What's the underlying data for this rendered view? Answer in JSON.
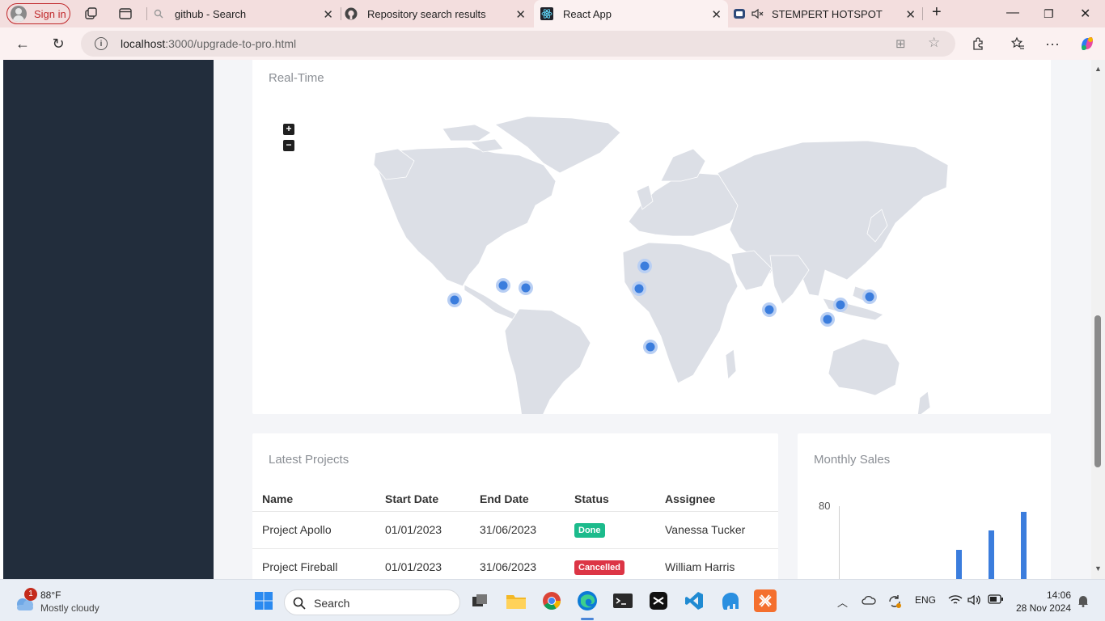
{
  "browser": {
    "signin_label": "Sign in",
    "tabs": [
      {
        "title": "github - Search"
      },
      {
        "title": "Repository search results"
      },
      {
        "title": "React App"
      },
      {
        "title": "STEMPERT HOTSPOT"
      }
    ],
    "url_host": "localhost",
    "url_path": ":3000/upgrade-to-pro.html"
  },
  "realtime": {
    "title": "Real-Time",
    "zoom_in": "+",
    "zoom_out": "−"
  },
  "projects": {
    "title": "Latest Projects",
    "columns": [
      "Name",
      "Start Date",
      "End Date",
      "Status",
      "Assignee"
    ],
    "rows": [
      {
        "name": "Project Apollo",
        "start": "01/01/2023",
        "end": "31/06/2023",
        "status": "Done",
        "assignee": "Vanessa Tucker"
      },
      {
        "name": "Project Fireball",
        "start": "01/01/2023",
        "end": "31/06/2023",
        "status": "Cancelled",
        "assignee": "William Harris"
      }
    ]
  },
  "sales": {
    "title": "Monthly Sales",
    "y_tick": "80"
  },
  "taskbar": {
    "notification_count": "1",
    "temperature": "88°F",
    "weather": "Mostly cloudy",
    "search_label": "Search",
    "language": "ENG",
    "time": "14:06",
    "date": "28 Nov 2024"
  },
  "colors": {
    "sidebar": "#222d3c",
    "marker": "#3b7ddd",
    "done": "#1cbb8c",
    "cancelled": "#dc3545",
    "tabstrip": "#f3dede"
  }
}
